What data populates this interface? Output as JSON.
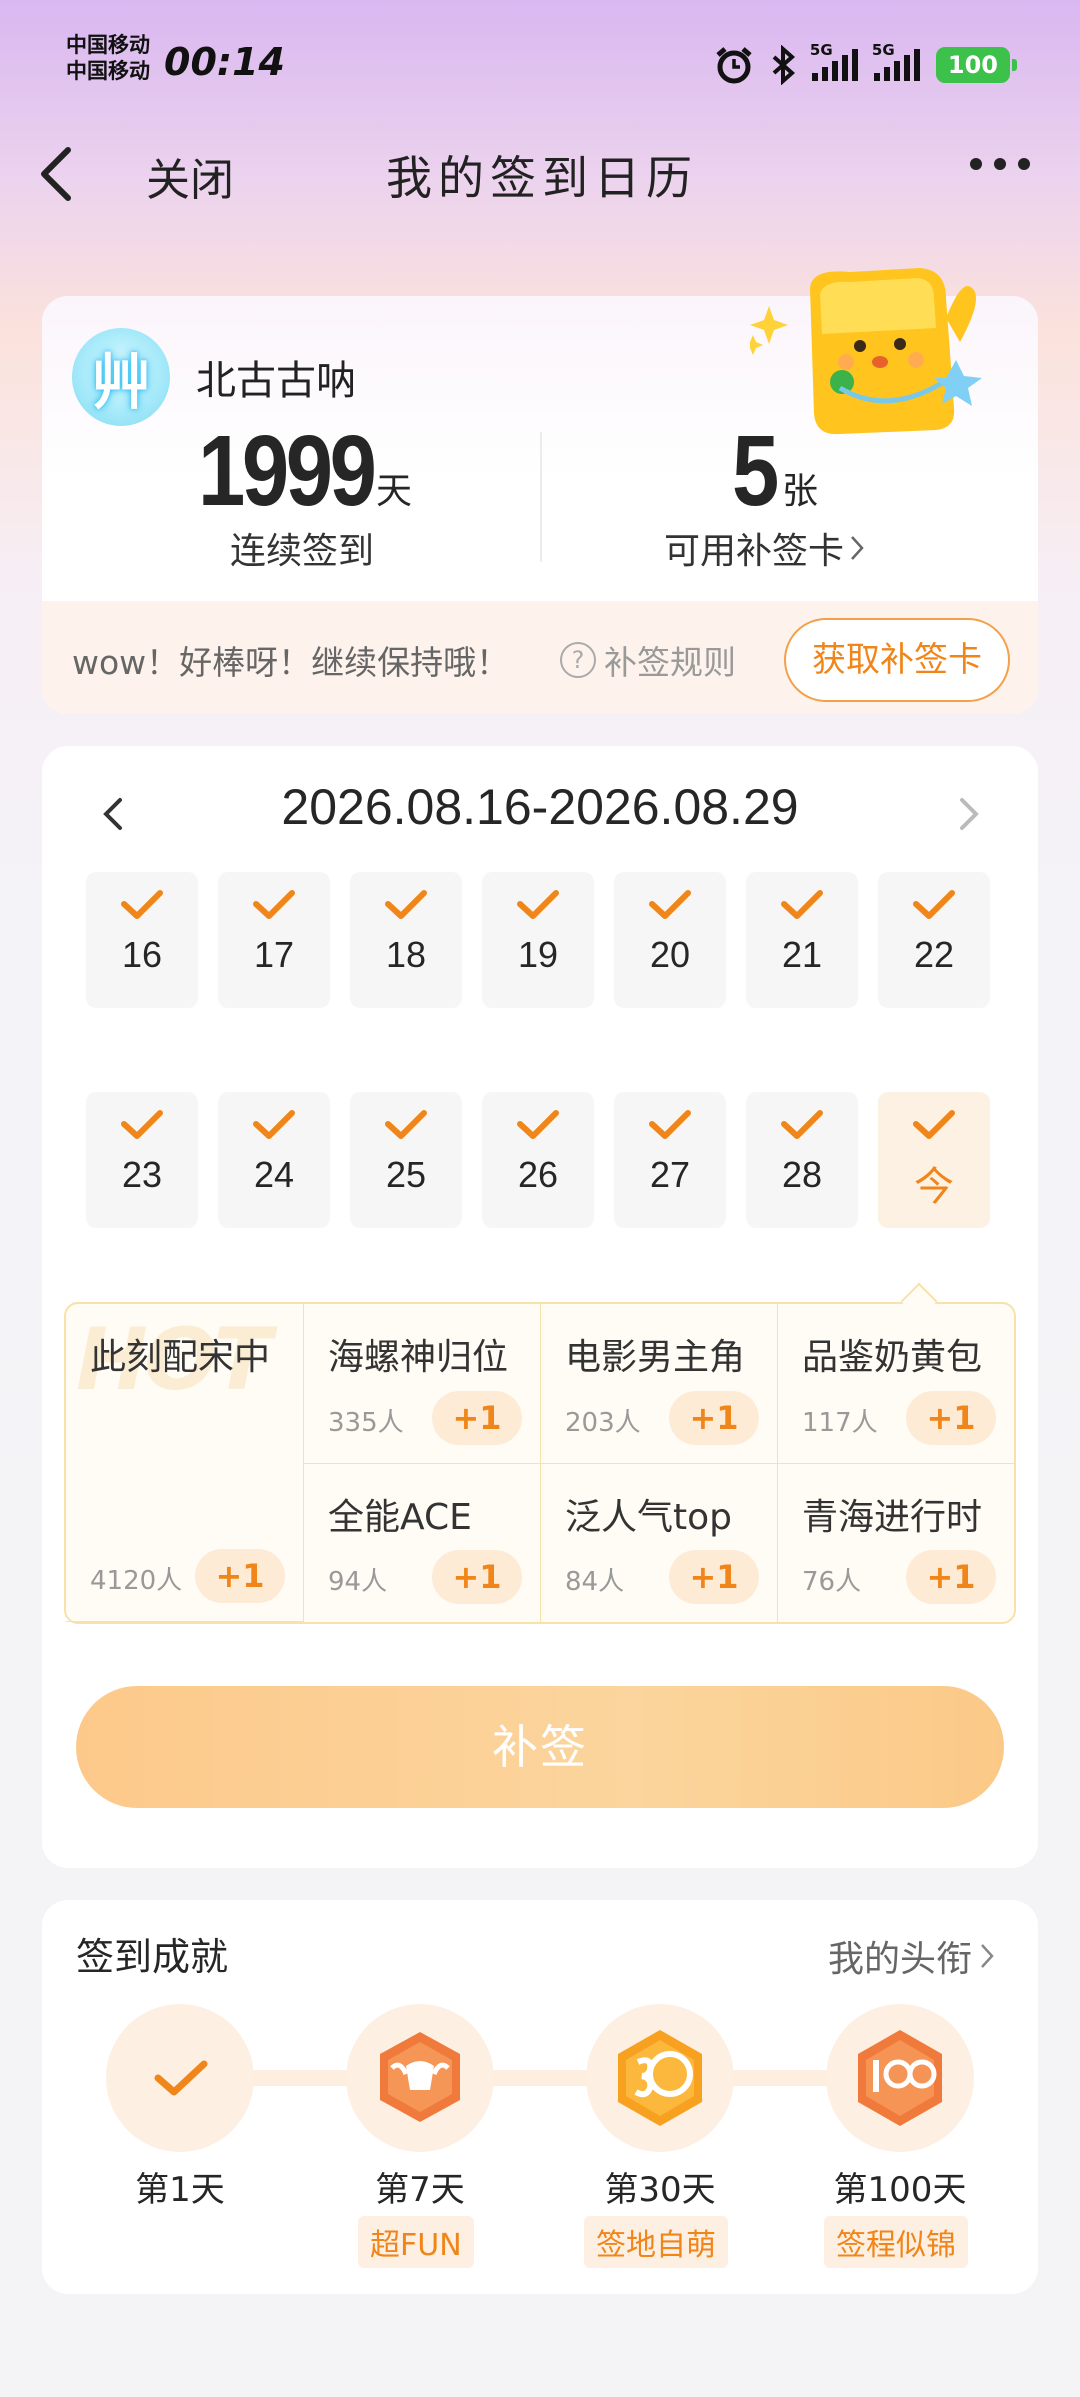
{
  "status_bar": {
    "carrier_1": "中国移动",
    "carrier_2": "中国移动",
    "time": "00:14",
    "net_1": "5G",
    "net_2": "5G",
    "battery": "100"
  },
  "header": {
    "close": "关闭",
    "title": "我的签到日历"
  },
  "profile": {
    "avatar_glyph": "艸",
    "username": "北古古呐",
    "streak_value": "1999",
    "streak_unit": "天",
    "streak_label": "连续签到",
    "cards_value": "5",
    "cards_unit": "张",
    "cards_label": "可用补签卡",
    "cheer": "wow！好棒呀！继续保持哦！",
    "rule": "补签规则",
    "get_card": "获取补签卡"
  },
  "calendar": {
    "range": "2026.08.16-2026.08.29",
    "week1": [
      "16",
      "17",
      "18",
      "19",
      "20",
      "21",
      "22"
    ],
    "week2": [
      "23",
      "24",
      "25",
      "26",
      "27",
      "28",
      "今"
    ]
  },
  "topics": {
    "hot_watermark": "HOT",
    "plus": "+1",
    "featured": {
      "name": "此刻配宋中",
      "count": "4120人"
    },
    "items": [
      {
        "name": "海螺神归位",
        "count": "335人"
      },
      {
        "name": "电影男主角",
        "count": "203人"
      },
      {
        "name": "品鉴奶黄包",
        "count": "117人"
      },
      {
        "name": "全能ACE",
        "count": "94人"
      },
      {
        "name": "泛人气top",
        "count": "84人"
      },
      {
        "name": "青海进行时",
        "count": "76人"
      }
    ]
  },
  "resign_button": "补签",
  "achievements": {
    "title": "签到成就",
    "link": "我的头衔",
    "items": [
      {
        "day": "第1天",
        "tag": ""
      },
      {
        "day": "第7天",
        "tag": "超FUN"
      },
      {
        "day": "第30天",
        "tag": "签地自萌"
      },
      {
        "day": "第100天",
        "tag": "签程似锦"
      }
    ]
  },
  "colors": {
    "accent": "#f0861a",
    "button": "#fdc98b"
  }
}
